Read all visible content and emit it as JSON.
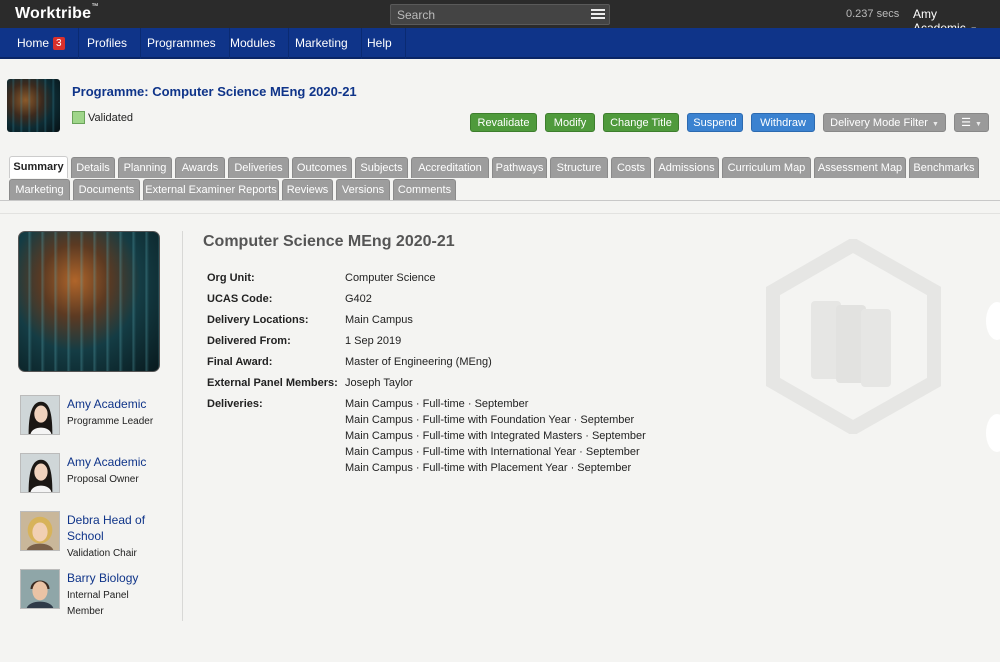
{
  "topbar": {
    "logo": "Worktribe",
    "logo_tm": "™",
    "search_placeholder": "Search",
    "timing": "0.237 secs",
    "user": "Amy Academic"
  },
  "nav": {
    "items": [
      {
        "label": "Home",
        "badge": "3"
      },
      {
        "label": "Profiles"
      },
      {
        "label": "Programmes"
      },
      {
        "label": "Modules"
      },
      {
        "label": "Marketing"
      },
      {
        "label": "Help"
      }
    ]
  },
  "header": {
    "title": "Programme: Computer Science MEng 2020-21",
    "status": "Validated",
    "status_color": "#9fd68a",
    "buttons": {
      "revalidate": "Revalidate",
      "modify": "Modify",
      "change_title": "Change Title",
      "suspend": "Suspend",
      "withdraw": "Withdraw",
      "delivery_filter": "Delivery Mode Filter"
    }
  },
  "tabs": {
    "row1": [
      "Summary",
      "Details",
      "Planning",
      "Awards",
      "Deliveries",
      "Outcomes",
      "Subjects",
      "Accreditation",
      "Pathways",
      "Structure",
      "Costs",
      "Admissions",
      "Curriculum Map",
      "Assessment Map",
      "Benchmarks"
    ],
    "row2": [
      "Marketing",
      "Documents",
      "External Examiner Reports",
      "Reviews",
      "Versions",
      "Comments"
    ],
    "active": "Summary"
  },
  "people": [
    {
      "name": "Amy Academic",
      "role": "Programme Leader"
    },
    {
      "name": "Amy Academic",
      "role": "Proposal Owner"
    },
    {
      "name": "Debra Head of School",
      "role": "Validation Chair"
    },
    {
      "name": "Barry Biology",
      "role": "Internal Panel Member"
    }
  ],
  "summary": {
    "title": "Computer Science MEng 2020-21",
    "fields": [
      {
        "label": "Org Unit:",
        "value": "Computer Science"
      },
      {
        "label": "UCAS Code:",
        "value": "G402"
      },
      {
        "label": "Delivery Locations:",
        "value": "Main Campus"
      },
      {
        "label": "Delivered From:",
        "value": "1 Sep 2019"
      },
      {
        "label": "Final Award:",
        "value": "Master of Engineering (MEng)"
      },
      {
        "label": "External Panel Members:",
        "value": "Joseph Taylor"
      }
    ],
    "deliveries_label": "Deliveries:",
    "deliveries": [
      "Main Campus · Full-time · September",
      "Main Campus · Full-time with Foundation Year · September",
      "Main Campus · Full-time with Integrated Masters · September",
      "Main Campus · Full-time with International Year · September",
      "Main Campus · Full-time with Placement Year · September"
    ]
  },
  "colors": {
    "nav_bg": "#0f3489",
    "topbar_bg": "#2b2b2b",
    "green_button": "#4f9a3c",
    "blue_button": "#3b82d0",
    "badge": "#d9302c"
  }
}
